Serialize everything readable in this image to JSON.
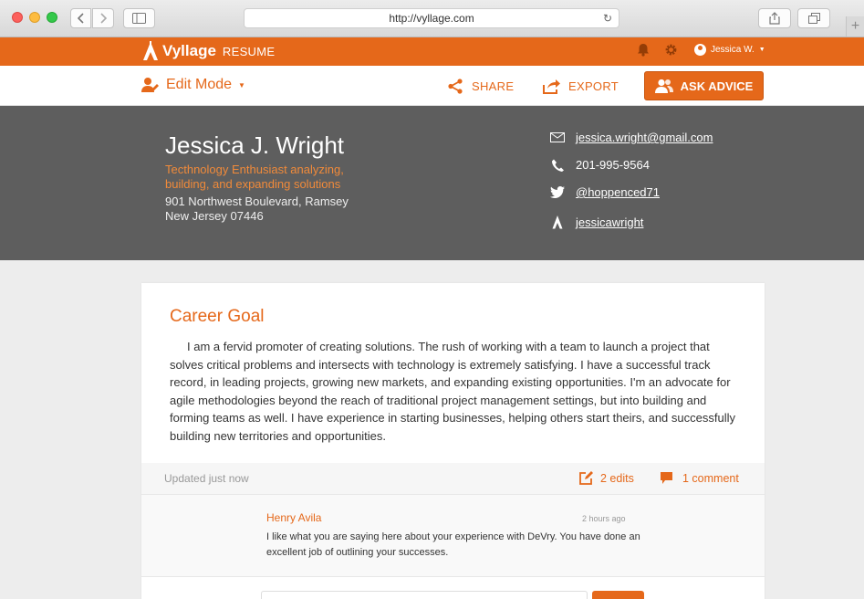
{
  "browser": {
    "url": "http://vyllage.com"
  },
  "nav": {
    "brand": "Vyllage",
    "section": "RESUME",
    "user_name": "Jessica W."
  },
  "toolbar": {
    "edit_mode": "Edit Mode",
    "share": "SHARE",
    "export": "EXPORT",
    "ask_advice": "ASK ADVICE"
  },
  "profile": {
    "name": "Jessica J. Wright",
    "tagline": "Tecthnology Enthusiast analyzing, building, and expanding solutions",
    "address_line1": "901 Northwest Boulevard, Ramsey",
    "address_line2": "New Jersey 07446",
    "email": "jessica.wright@gmail.com",
    "phone": "201-995-9564",
    "twitter": "@hoppenced71",
    "vyllage": "jessicawright"
  },
  "career_goal": {
    "title": "Career Goal",
    "body": "I am a fervid promoter of creating solutions. The rush of working with a team to launch a project that solves critical problems and intersects with technology is extremely satisfying. I have a successful track record, in leading projects, growing new markets, and expanding existing opportunities. I'm an advocate for agile methodologies beyond the reach of traditional project management settings, but into building and forming teams as well. I have experience in starting businesses, helping others start theirs, and successfully building new territories and opportunities.",
    "updated": "Updated just now",
    "edits": "2 edits",
    "comments": "1 comment"
  },
  "comment": {
    "author": "Henry Avila",
    "time": "2 hours ago",
    "text": "I like what you are saying here about your experience with DeVry. You have done an excellent job of outlining your successes."
  },
  "colors": {
    "brand": "#e5681a",
    "header_bg": "#5e5e5e",
    "page_bg": "#ededed"
  }
}
